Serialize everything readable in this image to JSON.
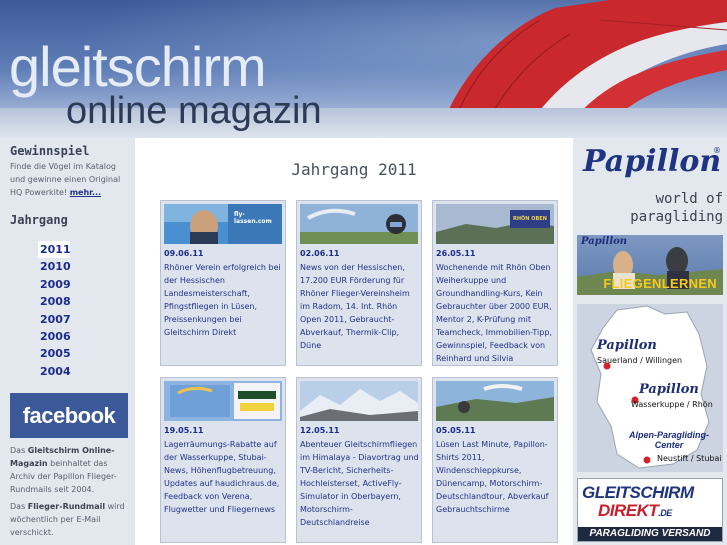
{
  "header": {
    "logo_main": "gleitschirm",
    "logo_sub": "online magazin"
  },
  "left": {
    "gewinnspiel_title": "Gewinnspiel",
    "gewinnspiel_text": "Finde die Vögel im Katalog und gewinne einen Original HQ Powerkite!",
    "gewinnspiel_link": "mehr...",
    "jahrgang_title": "Jahrgang",
    "years": [
      "2011",
      "2010",
      "2009",
      "2008",
      "2007",
      "2006",
      "2005",
      "2004"
    ],
    "active_year": "2011",
    "facebook_label": "facebook",
    "info1_pre": "Das ",
    "info1_bold": "Gleitschirm Online-Magazin",
    "info1_post": " beinhaltet das Archiv der Papillon Flieger-Rundmails seit 2004.",
    "info2_pre": "Das ",
    "info2_bold": "Flieger-Rundmail",
    "info2_post": " wird wöchentlich per E-Mail verschickt."
  },
  "main": {
    "title": "Jahrgang 2011",
    "cards": [
      {
        "date": "09.06.11",
        "img_label": "fly-lassen.com",
        "text": "Rhöner Verein erfolgreich bei der Hessischen Landesmeisterschaft, Pfingstfliegen in Lüsen, Preissenkungen bei Gleitschirm Direkt"
      },
      {
        "date": "02.06.11",
        "img_label": "",
        "text": "News von der Hessischen, 17.200 EUR Förderung für Rhöner Flieger-Vereinsheim im Radom, 14. Int. Rhön Open 2011, Gebraucht-Abverkauf, Thermik-Clip, Düne"
      },
      {
        "date": "26.05.11",
        "img_label": "RHÖN OBEN",
        "text": "Wochenende mit Rhön Oben Weiherkuppe und Groundhandling-Kurs, Kein Gebrauchter über 2000 EUR, Mentor 2, K-Prüfung mit Teamcheck, Immobilien-Tipp, Gewinnspiel, Feedback von Reinhard und Silvia"
      },
      {
        "date": "19.05.11",
        "img_label": "",
        "text": "Lagerräumungs-Rabatte auf der Wasserkuppe, Stubai-News, Höhenflugbetreuung, Updates auf haudichraus.de, Feedback von Verena, Flugwetter und Fliegernews"
      },
      {
        "date": "12.05.11",
        "img_label": "",
        "text": "Abenteuer Gleitschirmfliegen im Himalaya - Diavortrag und TV-Bericht, Sicherheits-Hochleisterset, ActiveFly-Simulator in Oberbayern, Motorschirm-Deutschlandreise"
      },
      {
        "date": "05.05.11",
        "img_label": "",
        "text": "Lüsen Last Minute, Papillon-Shirts 2011, Windenschleppkurse, Dünencamp, Motorschirm-Deutschlandtour, Abverkauf Gebrauchtschirme"
      }
    ]
  },
  "right": {
    "papillon_brand": "Papillon",
    "papillon_reg": "®",
    "world_of_paragliding": "world of paragliding",
    "fliegenlernen_brand": "Papillon",
    "fliegenlernen": "FLIEGENLERNEN",
    "map_brand1": "Papillon",
    "map_loc1": "Sauerland / Willingen",
    "map_brand2": "Papillon",
    "map_loc2": "Wasserkuppe / Rhön",
    "map_alpen": "Alpen-Paragliding-Center",
    "map_loc3": "Neustift / Stubai",
    "gd_line1": "GLEITSCHIRM",
    "gd_line2": "DIREKT",
    "gd_tld": ".DE",
    "gd_line3": "PARAGLIDING VERSAND"
  },
  "colors": {
    "link_blue": "#22318a",
    "year_blue": "#1c2c8a",
    "facebook_blue": "#3b5998",
    "card_bg": "#dde3ec",
    "sidebar_bg": "#e3e7ee"
  }
}
